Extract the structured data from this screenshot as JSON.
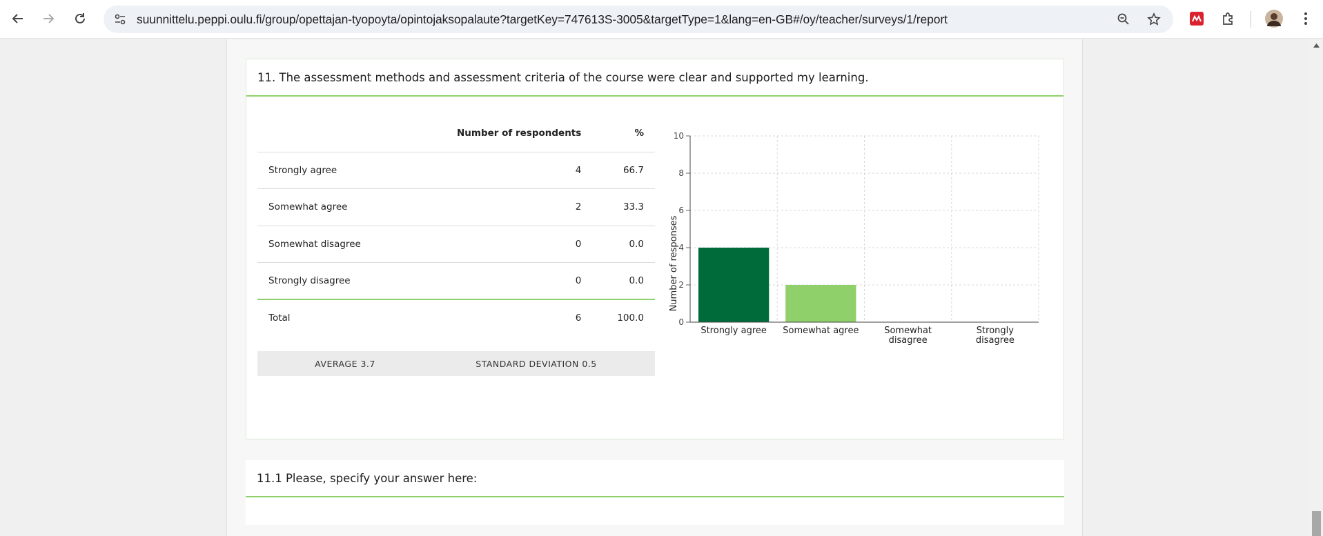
{
  "browser": {
    "url": "suunnittelu.peppi.oulu.fi/group/opettajan-tyopoyta/opintojaksopalaute?targetKey=747613S-3005&targetType=1&lang=en-GB#/oy/teacher/surveys/1/report"
  },
  "question": {
    "title": "11. The assessment methods and assessment criteria of the course were clear and supported my learning.",
    "table": {
      "col_respondents": "Number of respondents",
      "col_percent": "%",
      "rows": [
        {
          "label": "Strongly agree",
          "count": "4",
          "percent": "66.7"
        },
        {
          "label": "Somewhat agree",
          "count": "2",
          "percent": "33.3"
        },
        {
          "label": "Somewhat disagree",
          "count": "0",
          "percent": "0.0"
        },
        {
          "label": "Strongly disagree",
          "count": "0",
          "percent": "0.0"
        }
      ],
      "total": {
        "label": "Total",
        "count": "6",
        "percent": "100.0"
      }
    },
    "average": "AVERAGE 3.7",
    "std_dev": "STANDARD DEVIATION 0.5"
  },
  "chart_data": {
    "type": "bar",
    "categories": [
      "Strongly agree",
      "Somewhat agree",
      "Somewhat disagree",
      "Strongly disagree"
    ],
    "values": [
      4,
      2,
      0,
      0
    ],
    "colors": [
      "#006b3a",
      "#8fd06a",
      "#8fd06a",
      "#8fd06a"
    ],
    "ylabel": "Number of responses",
    "xlabel": "",
    "ylim": [
      0,
      10
    ],
    "yticks": [
      "0",
      "2",
      "4",
      "6",
      "8",
      "10"
    ],
    "grid": true
  },
  "followup": {
    "title": "11.1 Please, specify your answer here:"
  }
}
